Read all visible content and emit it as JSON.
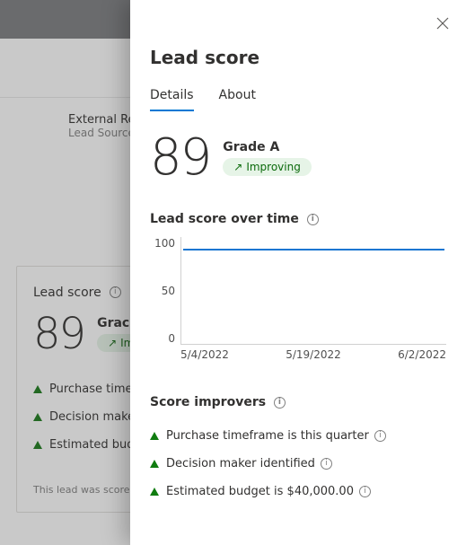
{
  "backdrop": {
    "external_referral_value": "External Re",
    "external_referral_label": "Lead Source",
    "card": {
      "title": "Lead score",
      "score": "89",
      "grade": "Grac",
      "trend_label": "Im",
      "improvers": [
        "Purchase timef",
        "Decision maker",
        "Estimated budg"
      ],
      "footer": "This lead was scored"
    }
  },
  "panel": {
    "title": "Lead score",
    "tabs": {
      "details": "Details",
      "about": "About"
    },
    "score": "89",
    "grade": "Grade A",
    "trend_label": "Improving",
    "chart_title": "Lead score over time",
    "improvers_title": "Score improvers",
    "improvers": [
      "Purchase timeframe is this quarter",
      "Decision maker identified",
      "Estimated budget is $40,000.00"
    ]
  },
  "chart_data": {
    "type": "line",
    "title": "Lead score over time",
    "x": [
      "5/4/2022",
      "5/19/2022",
      "6/2/2022"
    ],
    "values": [
      89,
      89,
      89
    ],
    "ylabel": "",
    "xlabel": "",
    "ylim": [
      0,
      100
    ],
    "yticks": [
      0,
      50,
      100
    ]
  }
}
